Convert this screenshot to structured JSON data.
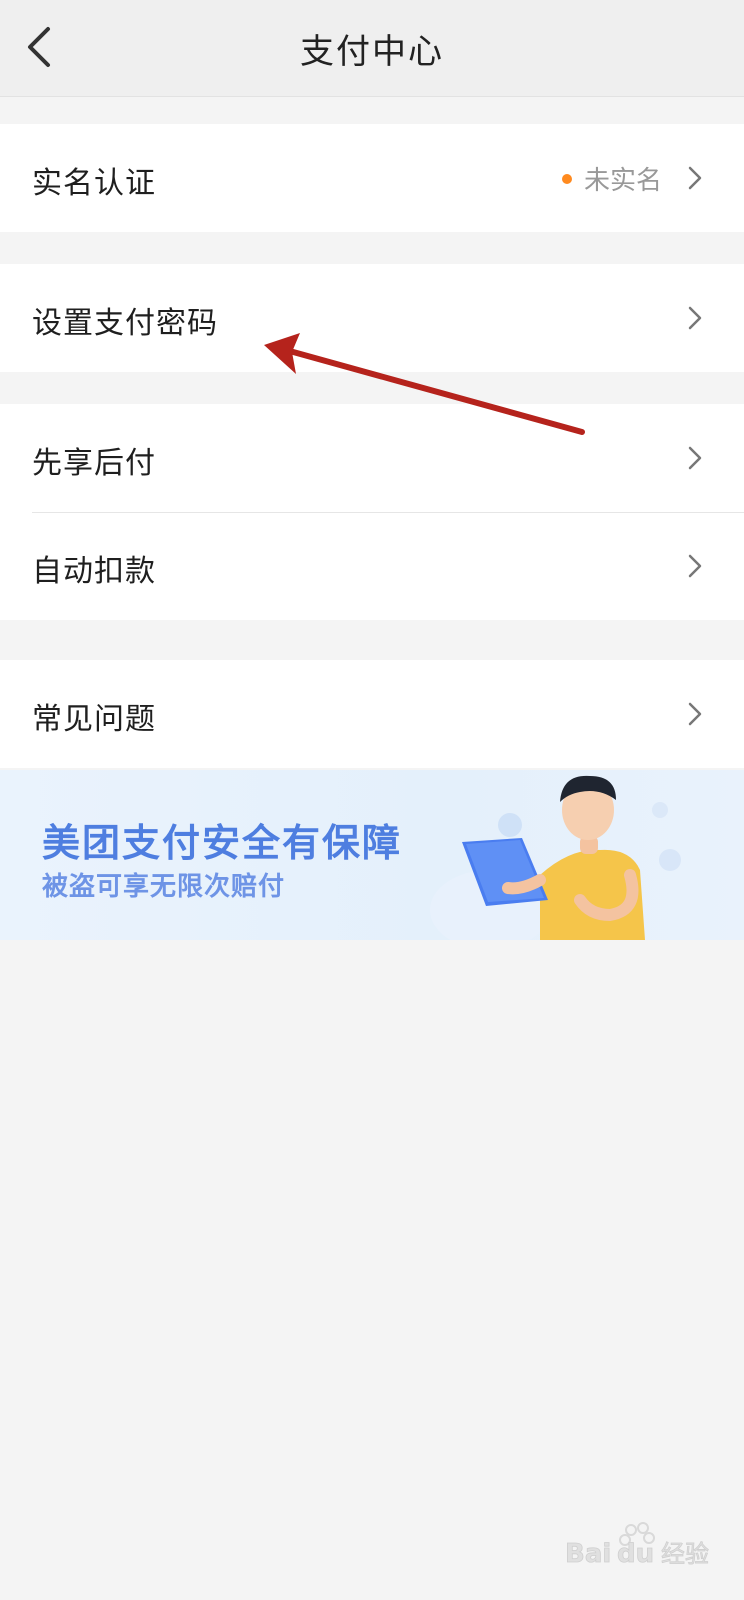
{
  "header": {
    "title": "支付中心",
    "back_icon": "chevron-left-icon"
  },
  "sections": [
    {
      "rows": [
        {
          "label": "实名认证",
          "status": "未实名",
          "status_color": "#ff8a1f"
        }
      ]
    },
    {
      "rows": [
        {
          "label": "设置支付密码"
        }
      ]
    },
    {
      "rows": [
        {
          "label": "先享后付"
        },
        {
          "label": "自动扣款"
        }
      ]
    },
    {
      "rows": [
        {
          "label": "常见问题"
        }
      ]
    }
  ],
  "banner": {
    "title": "美团支付安全有保障",
    "subtitle": "被盗可享无限次赔付",
    "title_color": "#4e7ee0"
  },
  "annotation": {
    "arrow_color": "#b5231c"
  },
  "watermark": {
    "text": "Baidu经验"
  }
}
